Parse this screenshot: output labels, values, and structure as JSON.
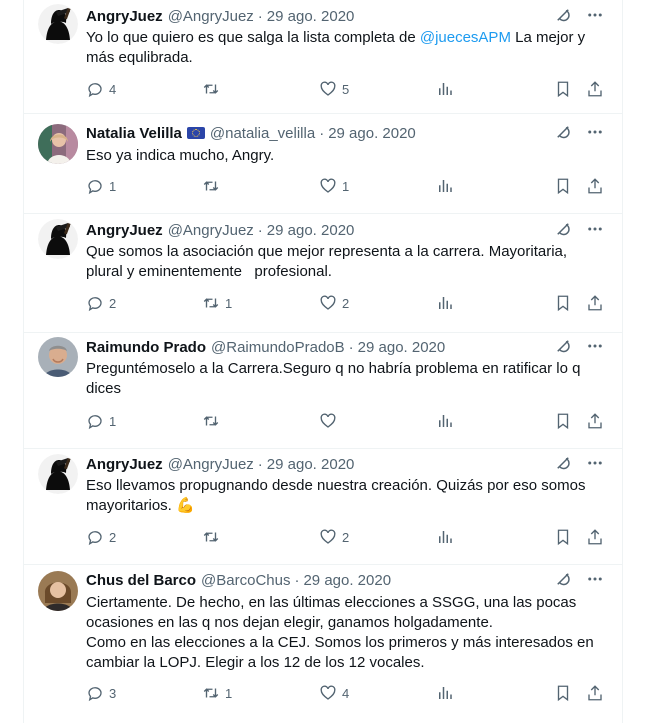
{
  "tweets": [
    {
      "name": "AngryJuez",
      "handle": "@AngryJuez",
      "date": "29 ago. 2020",
      "flag": false,
      "avatar": "hooded-figure",
      "text_parts": [
        "Yo lo que quiero es que salga la lista completa de ",
        "@juecesAPM",
        " La mejor y más equlibrada."
      ],
      "replies": "4",
      "retweets": "",
      "likes": "5"
    },
    {
      "name": "Natalia Velilla",
      "handle": "@natalia_velilla",
      "date": "29 ago. 2020",
      "flag": true,
      "avatar": "photo",
      "text": "Eso ya indica mucho, Angry.",
      "replies": "1",
      "retweets": "",
      "likes": "1"
    },
    {
      "name": "AngryJuez",
      "handle": "@AngryJuez",
      "date": "29 ago. 2020",
      "flag": false,
      "avatar": "hooded-figure",
      "text": "Que somos la asociación que mejor representa a la carrera. Mayoritaria, plural y eminentemente   profesional.",
      "replies": "2",
      "retweets": "1",
      "likes": "2"
    },
    {
      "name": "Raimundo Prado",
      "handle": "@RaimundoPradoB",
      "date": "29 ago. 2020",
      "flag": false,
      "avatar": "photo",
      "text": "Preguntémoselo a la Carrera.Seguro q no habría problema en ratificar lo q dices",
      "replies": "1",
      "retweets": "",
      "likes": ""
    },
    {
      "name": "AngryJuez",
      "handle": "@AngryJuez",
      "date": "29 ago. 2020",
      "flag": false,
      "avatar": "hooded-figure",
      "text": "Eso llevamos propugnando desde nuestra creación. Quizás por eso somos mayoritarios. 💪",
      "replies": "2",
      "retweets": "",
      "likes": "2"
    },
    {
      "name": "Chus del Barco",
      "handle": "@BarcoChus",
      "date": "29 ago. 2020",
      "flag": false,
      "avatar": "photo",
      "text_lines": [
        "Ciertamente. De hecho, en las últimas elecciones a SSGG, una las pocas ocasiones en las q nos dejan elegir, ganamos holgadamente.",
        "Como en las elecciones a la CEJ. Somos los primeros y más interesados en cambiar la LOPJ. Elegir a los 12 de los 12 vocales."
      ],
      "replies": "3",
      "retweets": "1",
      "likes": "4"
    }
  ],
  "icons": {
    "reply": "reply-icon",
    "retweet": "retweet-icon",
    "like": "heart-icon",
    "views": "views-icon",
    "bookmark": "bookmark-icon",
    "share": "share-icon",
    "grok": "grok-icon",
    "more": "more-icon"
  },
  "colors": {
    "text": "#0f1419",
    "secondary": "#536471",
    "link": "#1d9bf0",
    "border": "#eff3f4"
  }
}
